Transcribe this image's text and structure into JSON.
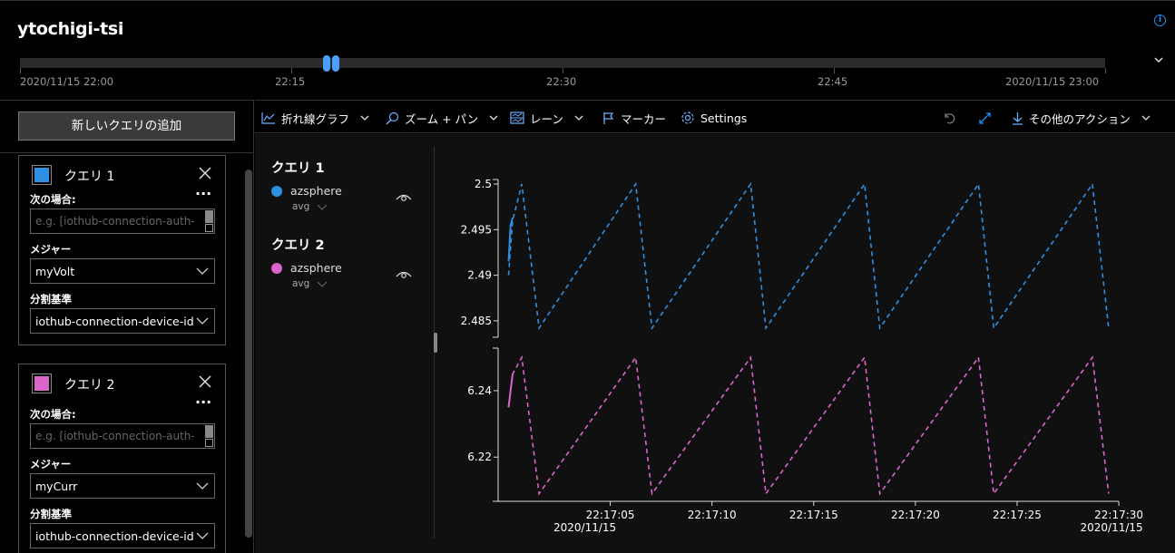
{
  "header": {
    "title": "ytochigi-tsi",
    "timeline": {
      "ticks": [
        "2020/11/15 22:00",
        "22:15",
        "22:30",
        "22:45",
        "2020/11/15 23:00"
      ]
    }
  },
  "left_panel": {
    "add_query_label": "新しいクエリの追加",
    "queries": [
      {
        "title": "クエリ 1",
        "color": "#2f8fe0",
        "filter_label": "次の場合:",
        "filter_placeholder": "e.g. [iothub-connection-auth-",
        "measure_label": "メジャー",
        "measure_value": "myVolt",
        "split_label": "分割基準",
        "split_value": "iothub-connection-device-id"
      },
      {
        "title": "クエリ 2",
        "color": "#d966c8",
        "filter_label": "次の場合:",
        "filter_placeholder": "e.g. [iothub-connection-auth-",
        "measure_label": "メジャー",
        "measure_value": "myCurr",
        "split_label": "分割基準",
        "split_value": "iothub-connection-device-id"
      }
    ]
  },
  "toolbar": {
    "chart_type": "折れ線グラフ",
    "zoom_pan": "ズーム + パン",
    "lanes": "レーン",
    "marker": "マーカー",
    "settings": "Settings",
    "more_actions": "その他のアクション"
  },
  "legend": [
    {
      "title": "クエリ 1",
      "series_name": "azsphere",
      "aggregation": "avg",
      "color": "#2f8fe0"
    },
    {
      "title": "クエリ 2",
      "series_name": "azsphere",
      "aggregation": "avg",
      "color": "#d966c8"
    }
  ],
  "chart_data": [
    {
      "type": "line",
      "series": [
        {
          "name": "azsphere",
          "color": "#2f8fe0"
        }
      ],
      "y_ticks": [
        "2.5",
        "2.495",
        "2.49",
        "2.485"
      ],
      "ylim": [
        2.4832,
        2.5005
      ],
      "x_tick_labels": [
        "22:17:05",
        "22:17:10",
        "22:17:15",
        "22:17:20",
        "22:17:25",
        "22:17:30"
      ],
      "x_date_labels": [
        "2020/11/15",
        "2020/11/15"
      ],
      "solid_segment": [
        [
          0,
          2.4915
        ],
        [
          0.1,
          2.4955
        ],
        [
          0.2,
          2.4963
        ]
      ],
      "points": [
        [
          0.0,
          2.49
        ],
        [
          0.2,
          2.496
        ],
        [
          0.65,
          2.5
        ],
        [
          1.5,
          2.4842
        ],
        [
          6.25,
          2.5
        ],
        [
          7.05,
          2.4842
        ],
        [
          11.9,
          2.5
        ],
        [
          12.65,
          2.4842
        ],
        [
          17.5,
          2.5
        ],
        [
          18.25,
          2.4842
        ],
        [
          23.1,
          2.5
        ],
        [
          23.85,
          2.4842
        ],
        [
          28.7,
          2.5
        ],
        [
          29.5,
          2.4842
        ]
      ]
    },
    {
      "type": "line",
      "series": [
        {
          "name": "azsphere",
          "color": "#d966c8"
        }
      ],
      "y_ticks": [
        "6.24",
        "6.22"
      ],
      "ylim": [
        6.2067,
        6.2528
      ],
      "points": [
        [
          0.0,
          6.235
        ],
        [
          0.2,
          6.245
        ],
        [
          0.65,
          6.25
        ],
        [
          1.5,
          6.209
        ],
        [
          6.25,
          6.25
        ],
        [
          7.05,
          6.209
        ],
        [
          11.9,
          6.25
        ],
        [
          12.65,
          6.209
        ],
        [
          17.5,
          6.25
        ],
        [
          18.25,
          6.209
        ],
        [
          23.1,
          6.25
        ],
        [
          23.85,
          6.209
        ],
        [
          28.7,
          6.25
        ],
        [
          29.5,
          6.209
        ]
      ]
    }
  ]
}
